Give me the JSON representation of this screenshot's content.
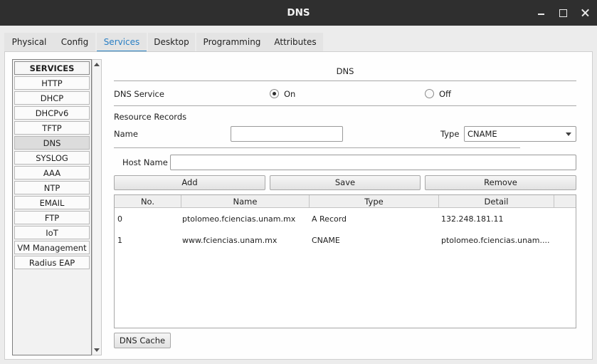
{
  "window": {
    "title": "DNS"
  },
  "tabs": [
    {
      "label": "Physical"
    },
    {
      "label": "Config"
    },
    {
      "label": "Services",
      "active": true
    },
    {
      "label": "Desktop"
    },
    {
      "label": "Programming"
    },
    {
      "label": "Attributes"
    }
  ],
  "services": {
    "header": "SERVICES",
    "items": [
      {
        "label": "HTTP"
      },
      {
        "label": "DHCP"
      },
      {
        "label": "DHCPv6"
      },
      {
        "label": "TFTP"
      },
      {
        "label": "DNS",
        "selected": true
      },
      {
        "label": "SYSLOG"
      },
      {
        "label": "AAA"
      },
      {
        "label": "NTP"
      },
      {
        "label": "EMAIL"
      },
      {
        "label": "FTP"
      },
      {
        "label": "IoT"
      },
      {
        "label": "VM Management"
      },
      {
        "label": "Radius EAP"
      }
    ]
  },
  "dns": {
    "section_title": "DNS",
    "service_label": "DNS Service",
    "on_label": "On",
    "off_label": "Off",
    "service_state": "On",
    "resource_records_label": "Resource Records",
    "name_label": "Name",
    "name_value": "",
    "type_label": "Type",
    "type_value": "CNAME",
    "host_name_label": "Host Name",
    "host_name_value": "",
    "buttons": {
      "add": "Add",
      "save": "Save",
      "remove": "Remove"
    },
    "table": {
      "headers": [
        "No.",
        "Name",
        "Type",
        "Detail"
      ],
      "rows": [
        [
          "0",
          "ptolomeo.fciencias.unam.mx",
          "A Record",
          "132.248.181.11"
        ],
        [
          "1",
          "www.fciencias.unam.mx",
          "CNAME",
          "ptolomeo.fciencias.unam...."
        ]
      ]
    },
    "cache_button": "DNS Cache"
  },
  "colors": {
    "accent": "#2a86c8",
    "titlebar": "#2f2f2f"
  }
}
